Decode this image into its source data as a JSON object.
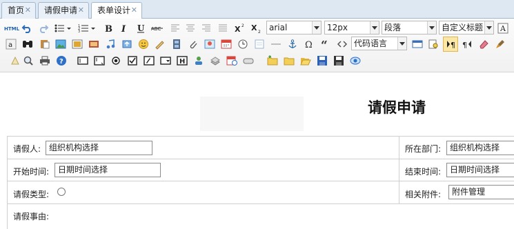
{
  "tabs": [
    {
      "label": "首页",
      "close": "✕"
    },
    {
      "label": "请假申请",
      "close": "✕"
    },
    {
      "label": "表单设计",
      "close": "✕"
    }
  ],
  "toolbar": {
    "font_family": "arial",
    "font_size": "12px",
    "paragraph": "段落",
    "custom_title": "自定义标题",
    "code_language": "代码语言"
  },
  "form": {
    "title": "请假申请",
    "applicant_label": "请假人:",
    "applicant_value": "组织机构选择",
    "dept_label": "所在部门:",
    "dept_value": "组织机构选择",
    "start_label": "开始时间:",
    "start_value": "日期时间选择",
    "end_label": "结束时间:",
    "end_value": "日期时间选择",
    "type_label": "请假类型:",
    "attach_label": "相关附件:",
    "attach_value": "附件管理",
    "reason_label": "请假事由:"
  },
  "colors": {
    "accent": "#1a5fb4",
    "active_button": "#fbe8a6",
    "tab_bar": "#dde8f3"
  }
}
